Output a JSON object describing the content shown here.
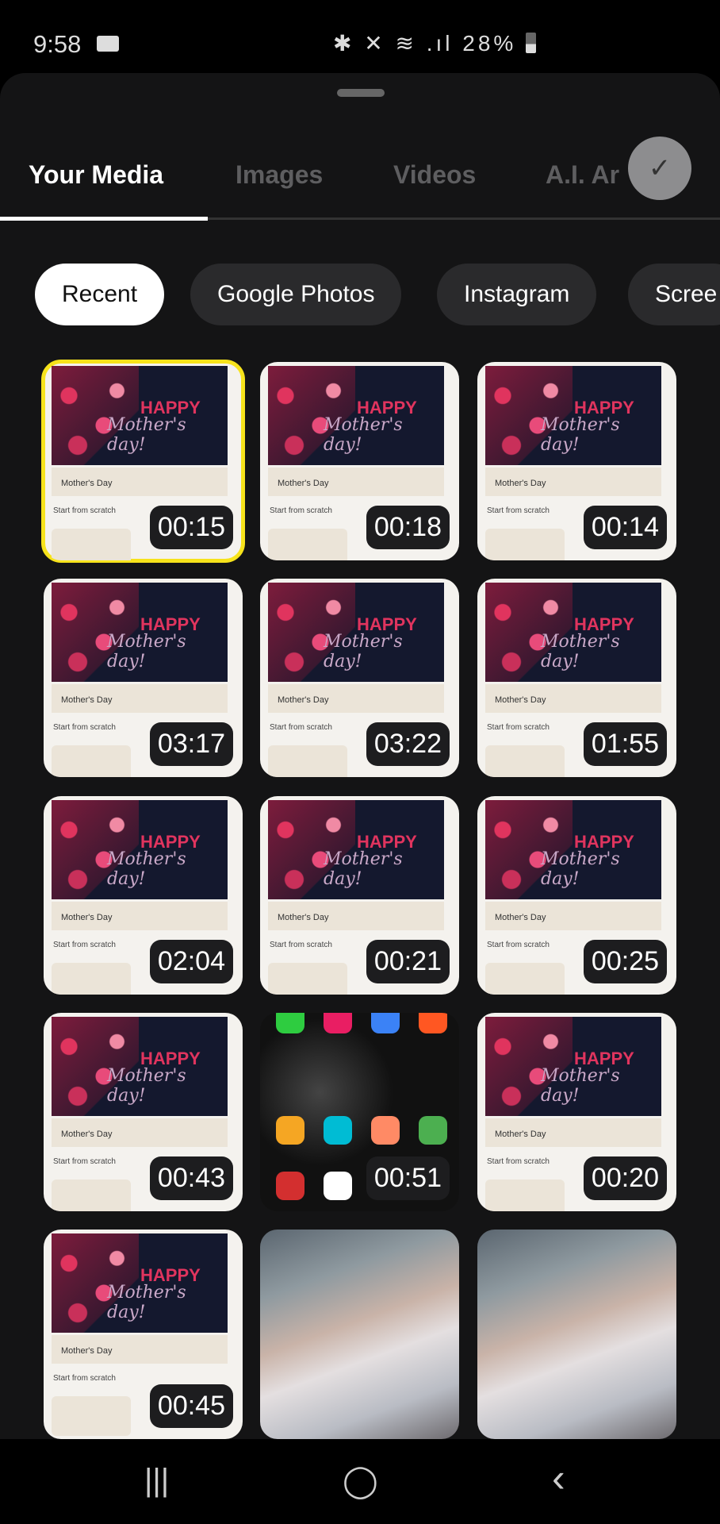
{
  "status_bar": {
    "time": "9:58",
    "icons": "✱ ✕ ≋ .ıl",
    "battery": "28%"
  },
  "tabs": [
    {
      "label": "Your Media",
      "active": true
    },
    {
      "label": "Images"
    },
    {
      "label": "Videos"
    },
    {
      "label": "A.I. Ar"
    }
  ],
  "confirm_icon": "checkmark-icon",
  "chips": [
    {
      "label": "Recent",
      "active": true
    },
    {
      "label": "Google Photos"
    },
    {
      "label": "Instagram"
    },
    {
      "label": "Scree"
    }
  ],
  "thumbnail_text": {
    "happy": "HAPPY",
    "script": "Mother's day!",
    "band": "Mother's Day",
    "start": "Start from scratch"
  },
  "media": [
    {
      "type": "mothers-day",
      "duration": "00:15",
      "selected": true
    },
    {
      "type": "mothers-day",
      "duration": "00:18"
    },
    {
      "type": "mothers-day",
      "duration": "00:14"
    },
    {
      "type": "mothers-day",
      "duration": "03:17"
    },
    {
      "type": "mothers-day",
      "duration": "03:22"
    },
    {
      "type": "mothers-day",
      "duration": "01:55"
    },
    {
      "type": "mothers-day",
      "duration": "02:04"
    },
    {
      "type": "mothers-day",
      "duration": "00:21"
    },
    {
      "type": "mothers-day",
      "duration": "00:25"
    },
    {
      "type": "mothers-day",
      "duration": "00:43"
    },
    {
      "type": "app-screen",
      "duration": "00:51"
    },
    {
      "type": "mothers-day",
      "duration": "00:20"
    },
    {
      "type": "mothers-day",
      "duration": "00:45"
    },
    {
      "type": "photo"
    },
    {
      "type": "photo"
    }
  ],
  "accent_color": "#f7e31b",
  "nav_bar": {
    "recents": "|||",
    "home": "◯",
    "back": "‹"
  }
}
